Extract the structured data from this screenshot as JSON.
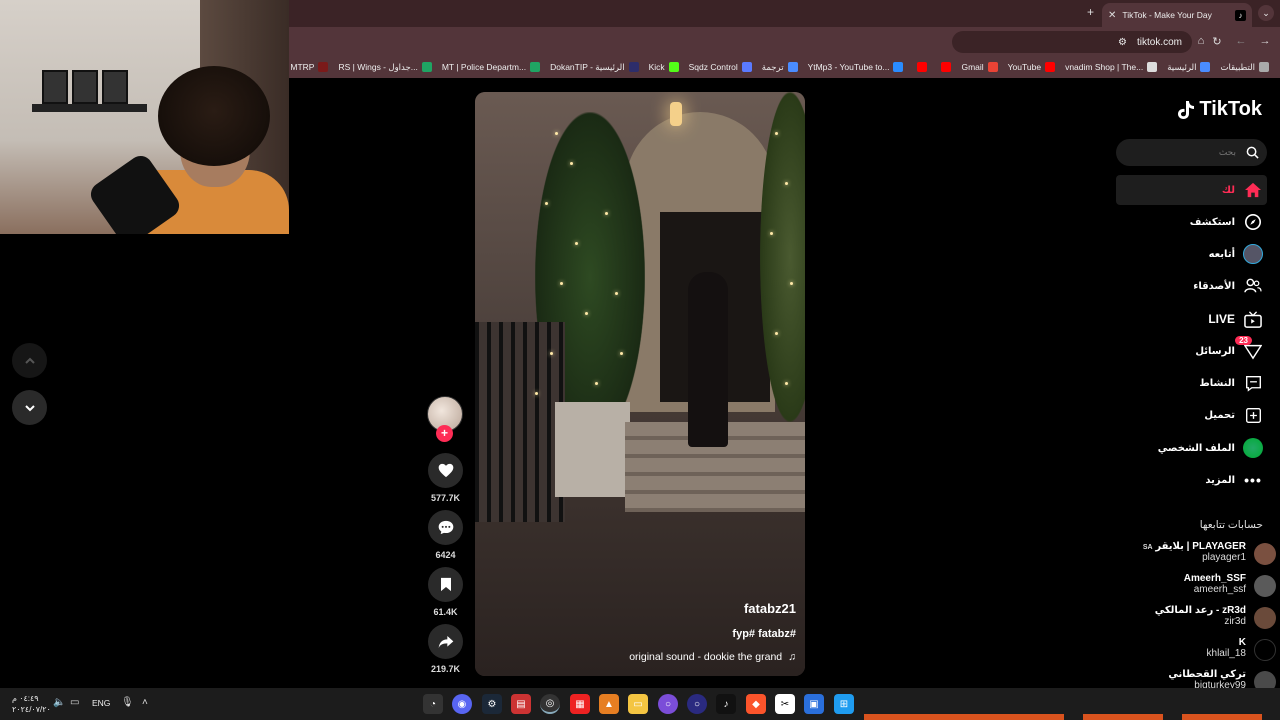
{
  "browser": {
    "tab_title": "TikTok - Make Your Day",
    "tab_favicon": "tiktok-icon",
    "url": "tiktok.com",
    "bookmarks": [
      {
        "label": "التطبيقات",
        "icon": "apps-grid-icon",
        "color": "#aaaaaa"
      },
      {
        "label": "الرئيسية",
        "icon": "blue-globe-icon",
        "color": "#4a8cff"
      },
      {
        "label": "vnadim Shop | The...",
        "icon": "globe-icon",
        "color": "#dddddd"
      },
      {
        "label": "YouTube",
        "icon": "youtube-icon",
        "color": "#ff0000"
      },
      {
        "label": "Gmail",
        "icon": "gmail-icon",
        "color": "#ea4335"
      },
      {
        "label": "",
        "icon": "youtube-icon",
        "color": "#ff0000"
      },
      {
        "label": "",
        "icon": "youtube-icon",
        "color": "#ff0000"
      },
      {
        "label": "YtMp3 - YouTube to...",
        "icon": "ytmp3-icon",
        "color": "#2a8cff"
      },
      {
        "label": "ترجمة",
        "icon": "translate-icon",
        "color": "#4a8cff"
      },
      {
        "label": "Sqdz Control",
        "icon": "sqdz-icon",
        "color": "#5a7aff"
      },
      {
        "label": "Kick",
        "icon": "kick-icon",
        "color": "#53fc18"
      },
      {
        "label": "DokanTIP - الرئيسية",
        "icon": "dokantip-icon",
        "color": "#2d2d6a"
      },
      {
        "label": "MT | Police Departm...",
        "icon": "sheets-icon",
        "color": "#1fa463"
      },
      {
        "label": "RS | Wings - جداول...",
        "icon": "sheets-icon",
        "color": "#1fa463"
      },
      {
        "label": "MTRP",
        "icon": "mtrp-icon",
        "color": "#7a1a1a"
      }
    ]
  },
  "sidebar": {
    "logo": "TikTok",
    "search_placeholder": "بحث",
    "nav": [
      {
        "label": "لك",
        "icon": "home-icon"
      },
      {
        "label": "استكشف",
        "icon": "compass-icon"
      },
      {
        "label": "أتابعه",
        "icon": "following-avatar-icon"
      },
      {
        "label": "الأصدقاء",
        "icon": "friends-icon"
      },
      {
        "label": "LIVE",
        "icon": "live-tv-icon"
      },
      {
        "label": "الرسائل",
        "icon": "messages-icon",
        "badge": "23"
      },
      {
        "label": "النشاط",
        "icon": "activity-icon"
      },
      {
        "label": "تحميل",
        "icon": "upload-icon"
      },
      {
        "label": "الملف الشخصي",
        "icon": "profile-avatar-icon"
      },
      {
        "label": "المزيد",
        "icon": "more-icon"
      }
    ],
    "following_title": "حسابات تتابعها",
    "following": [
      {
        "name": "بلايقر | PLAYAGER",
        "prefix": "SA",
        "handle": "playager1",
        "avatar_color": "#7a5040"
      },
      {
        "name": "Ameerh_SSF",
        "handle": "ameerh_ssf",
        "avatar_color": "#5a5a5a"
      },
      {
        "name": "رعد المالكي - zR3d",
        "handle": "zir3d",
        "avatar_color": "#6a4a3a"
      },
      {
        "name": "K",
        "handle": "khlail_18",
        "avatar_color": "#000000"
      },
      {
        "name": "تركي القحطاني",
        "handle": "bigturkey99",
        "avatar_color": "#4a4a4a"
      }
    ]
  },
  "video": {
    "author": "fatabz21",
    "tags": "fyp# fatabz#",
    "sound": "original sound - dookie the grand",
    "sound_icon": "music-note-icon"
  },
  "actions": {
    "likes": "577.7K",
    "comments": "6424",
    "saves": "61.4K",
    "shares": "219.7K"
  },
  "taskbar": {
    "time": "٠٤:٤٩ م",
    "date": "٢٠٢٤/٠٧/٢٠",
    "lang": "ENG"
  },
  "colors": {
    "accent": "#fe2c55",
    "browser_frame": "#53353a",
    "tab_strip": "#3b2326"
  }
}
